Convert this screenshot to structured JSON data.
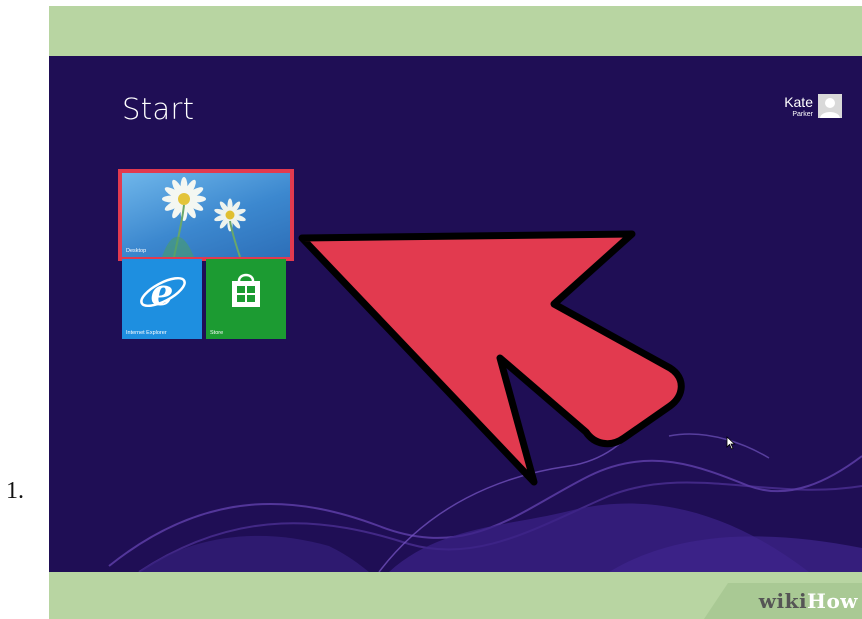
{
  "step": {
    "number": "1."
  },
  "start": {
    "title": "Start"
  },
  "user": {
    "first_name": "Kate",
    "last_name": "Parker",
    "avatar_icon": "user-silhouette-icon"
  },
  "tiles": [
    {
      "label": "Desktop",
      "icon": "daisy-wallpaper",
      "color": "#3c88cf"
    },
    {
      "label": "Internet Explorer",
      "icon": "ie-logo-icon",
      "color": "#1e8fe0"
    },
    {
      "label": "Store",
      "icon": "shopping-bag-icon",
      "color": "#1c9b32"
    }
  ],
  "annotation": {
    "arrow_color": "#e23a4f",
    "highlight_color": "#e23a4f"
  },
  "watermark": {
    "wiki": "wiki",
    "how": "How"
  },
  "colors": {
    "frame": "#b8d5a2",
    "screen_bg": "#1f0e55"
  }
}
